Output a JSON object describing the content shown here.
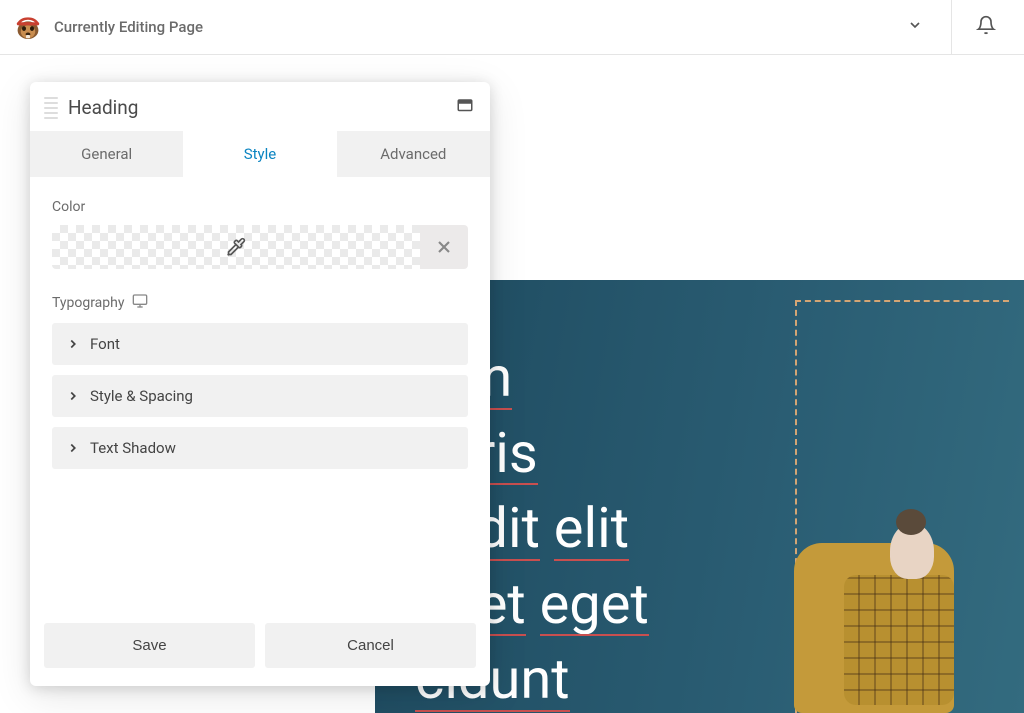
{
  "topbar": {
    "page_title": "Currently Editing Page"
  },
  "panel": {
    "title": "Heading",
    "tabs": {
      "general": "General",
      "style": "Style",
      "advanced": "Advanced"
    },
    "fields": {
      "color_label": "Color",
      "typography_label": "Typography",
      "font": "Font",
      "style_spacing": "Style & Spacing",
      "text_shadow": "Text Shadow"
    },
    "buttons": {
      "save": "Save",
      "cancel": "Cancel"
    }
  },
  "canvas": {
    "heading_lines": [
      [
        "rem"
      ],
      [
        "auris"
      ],
      [
        "andit",
        "elit"
      ],
      [
        "quet",
        "eget"
      ],
      [
        "cidunt"
      ]
    ]
  },
  "colors": {
    "accent": "#0a84c1",
    "canvas_bg_start": "#1e4a5f",
    "canvas_bg_end": "#336b7f",
    "dashed_border": "#d4a574",
    "spell_underline": "#c94f4f"
  }
}
